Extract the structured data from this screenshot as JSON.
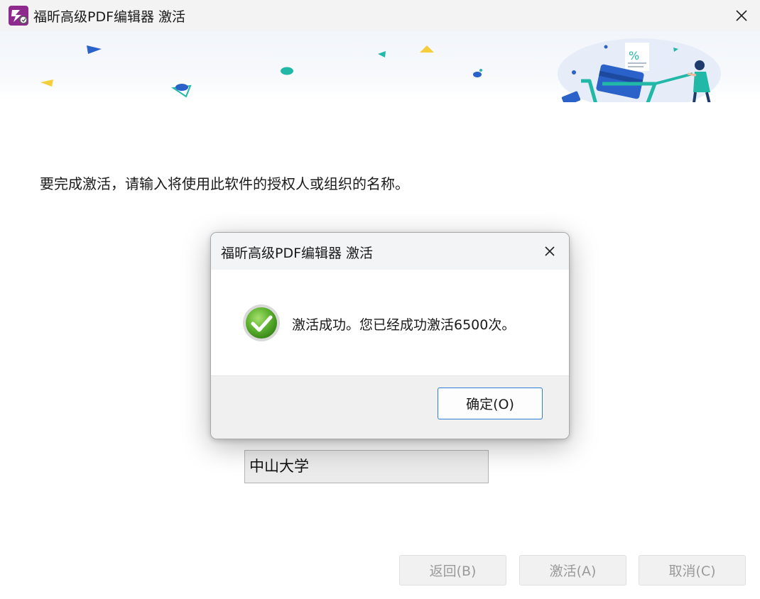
{
  "window": {
    "title": "福昕高级PDF编辑器 激活",
    "close_icon": "close-icon",
    "app_icon": "foxit-app-icon"
  },
  "main": {
    "instruction": "要完成激活，请输入将使用此软件的授权人或组织的名称。",
    "name_field_value": "中山大学",
    "buttons": {
      "back": "返回(B)",
      "activate": "激活(A)",
      "cancel": "取消(C)"
    }
  },
  "dialog": {
    "title": "福昕高级PDF编辑器 激活",
    "message": "激活成功。您已经成功激活6500次。",
    "ok_label": "确定(O)",
    "status_icon": "success-check-icon"
  },
  "colors": {
    "ok_border": "#2f7fd3",
    "success_green": "#5bb02d",
    "accent_teal": "#22b8a8",
    "accent_blue": "#2a62c9",
    "accent_yellow": "#f5cf3b"
  }
}
